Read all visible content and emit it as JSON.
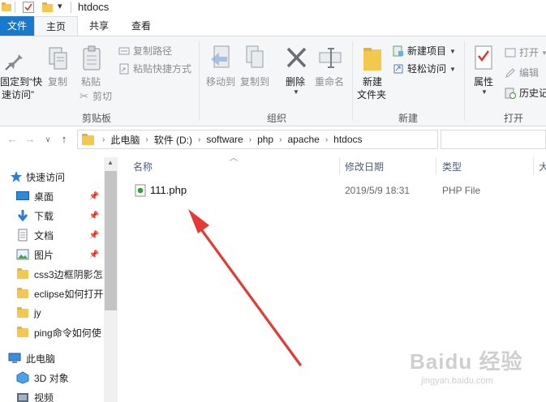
{
  "window": {
    "title": "htdocs"
  },
  "ribbon_tabs": [
    "文件",
    "主页",
    "共享",
    "查看"
  ],
  "ribbon": {
    "clipboard": {
      "pin_label_line1": "固定到“快",
      "pin_label_line2": "速访问”",
      "copy": "复制",
      "paste": "粘贴",
      "copy_path": "复制路径",
      "paste_shortcut": "粘贴快捷方式",
      "cut": "剪切",
      "group_label": "剪贴板"
    },
    "organize": {
      "move_to": "移动到",
      "copy_to": "复制到",
      "delete": "删除",
      "rename": "重命名",
      "group_label": "组织"
    },
    "new": {
      "new_folder_line1": "新建",
      "new_folder_line2": "文件夹",
      "new_item": "新建项目",
      "easy_access": "轻松访问",
      "group_label": "新建"
    },
    "open": {
      "properties": "属性",
      "open": "打开",
      "edit": "编辑",
      "history": "历史记",
      "group_label": "打开"
    }
  },
  "address": {
    "crumbs": [
      "此电脑",
      "软件 (D:)",
      "software",
      "php",
      "apache",
      "htdocs"
    ]
  },
  "nav_pane": {
    "quick_access": "快速访问",
    "items": [
      {
        "label": "桌面",
        "pinned": true,
        "icon": "desktop-icon"
      },
      {
        "label": "下载",
        "pinned": true,
        "icon": "download-icon"
      },
      {
        "label": "文档",
        "pinned": true,
        "icon": "document-icon"
      },
      {
        "label": "图片",
        "pinned": true,
        "icon": "picture-icon"
      },
      {
        "label": "css3边框阴影怎",
        "pinned": false,
        "icon": "folder-icon"
      },
      {
        "label": "eclipse如何打开",
        "pinned": false,
        "icon": "folder-icon"
      },
      {
        "label": "jy",
        "pinned": false,
        "icon": "folder-icon"
      },
      {
        "label": "ping命令如何使",
        "pinned": false,
        "icon": "folder-icon"
      }
    ],
    "this_pc": "此电脑",
    "pc_items": [
      {
        "label": "3D 对象",
        "icon": "3d-objects-icon"
      },
      {
        "label": "视频",
        "icon": "video-icon"
      }
    ]
  },
  "file_list": {
    "columns": [
      "名称",
      "修改日期",
      "类型",
      "大"
    ],
    "rows": [
      {
        "name": "111.php",
        "modified": "2019/5/9 18:31",
        "type": "PHP File"
      }
    ]
  },
  "watermark": {
    "brand": "Baidu 经验",
    "url": "jingyan.baidu.com"
  },
  "colors": {
    "file_tab": "#1979ca",
    "annotation_arrow": "#e53935",
    "folder": "#f4c84e"
  }
}
